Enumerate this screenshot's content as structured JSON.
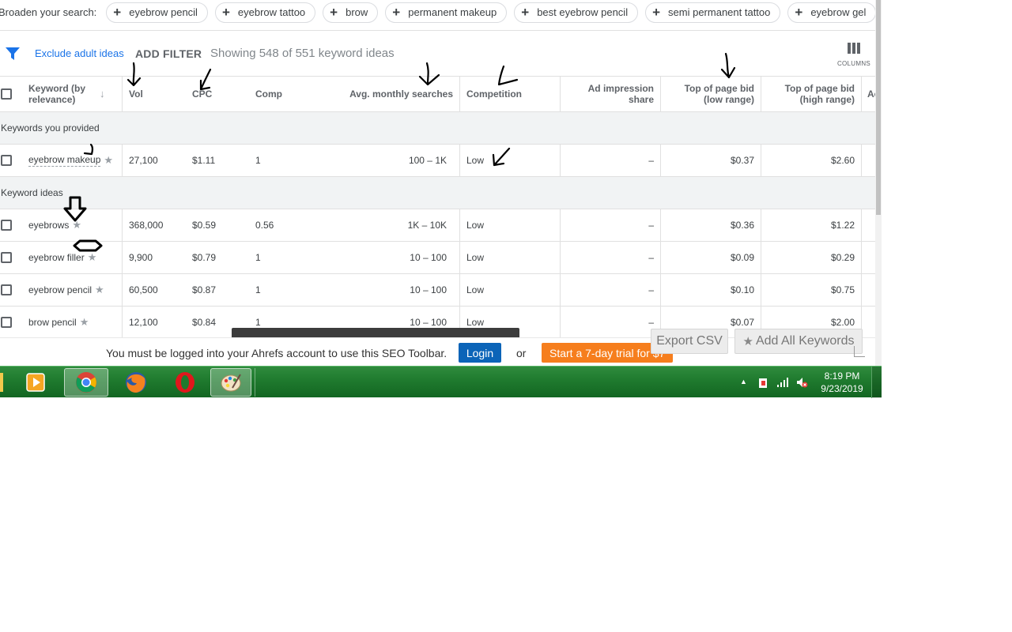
{
  "broaden": {
    "label": "Broaden your search:",
    "chips": [
      "eyebrow pencil",
      "eyebrow tattoo",
      "brow",
      "permanent makeup",
      "best eyebrow pencil",
      "semi permanent tattoo",
      "eyebrow gel"
    ]
  },
  "toolbar": {
    "exclude_label": "Exclude adult ideas",
    "add_filter_label": "ADD FILTER",
    "showing_text": "Showing 548 of 551 keyword ideas",
    "columns_label": "COLUMNS"
  },
  "table": {
    "headers": {
      "keyword": "Keyword (by relevance)",
      "vol": "Vol",
      "cpc": "CPC",
      "comp": "Comp",
      "avg": "Avg. monthly searches",
      "competition": "Competition",
      "ad_share": "Ad impression share",
      "bid_low": "Top of page bid (low range)",
      "bid_high": "Top of page bid (high range)",
      "account": "Ac"
    },
    "groups": [
      {
        "label": "Keywords you provided",
        "rows": [
          {
            "keyword": "eyebrow makeup",
            "vol": "27,100",
            "cpc": "$1.11",
            "comp": "1",
            "avg": "100 – 1K",
            "competition": "Low",
            "ad_share": "–",
            "bid_low": "$0.37",
            "bid_high": "$2.60"
          }
        ]
      },
      {
        "label": "Keyword ideas",
        "rows": [
          {
            "keyword": "eyebrows",
            "vol": "368,000",
            "cpc": "$0.59",
            "comp": "0.56",
            "avg": "1K – 10K",
            "competition": "Low",
            "ad_share": "–",
            "bid_low": "$0.36",
            "bid_high": "$1.22"
          },
          {
            "keyword": "eyebrow filler",
            "vol": "9,900",
            "cpc": "$0.79",
            "comp": "1",
            "avg": "10 – 100",
            "competition": "Low",
            "ad_share": "–",
            "bid_low": "$0.09",
            "bid_high": "$0.29"
          },
          {
            "keyword": "eyebrow pencil",
            "vol": "60,500",
            "cpc": "$0.87",
            "comp": "1",
            "avg": "10 – 100",
            "competition": "Low",
            "ad_share": "–",
            "bid_low": "$0.10",
            "bid_high": "$0.75"
          },
          {
            "keyword": "brow pencil",
            "vol": "12,100",
            "cpc": "$0.84",
            "comp": "1",
            "avg": "10 – 100",
            "competition": "Low",
            "ad_share": "–",
            "bid_low": "$0.07",
            "bid_high": "$2.00"
          }
        ]
      }
    ]
  },
  "ahrefs": {
    "message": "You must be logged into your Ahrefs account to use this SEO Toolbar.",
    "login_label": "Login",
    "or_label": "or",
    "trial_label": "Start a 7-day trial for $7",
    "export_label": "Export CSV",
    "add_all_label": "Add All Keywords"
  },
  "taskbar": {
    "apps": [
      "windows-media-player",
      "chrome",
      "firefox",
      "opera",
      "paint"
    ],
    "time": "8:19 PM",
    "date": "9/23/2019"
  },
  "colors": {
    "link_blue": "#1a73e8",
    "login_blue": "#0b64b8",
    "trial_orange": "#f67e1d",
    "taskbar_green": "#1f7a2e"
  }
}
